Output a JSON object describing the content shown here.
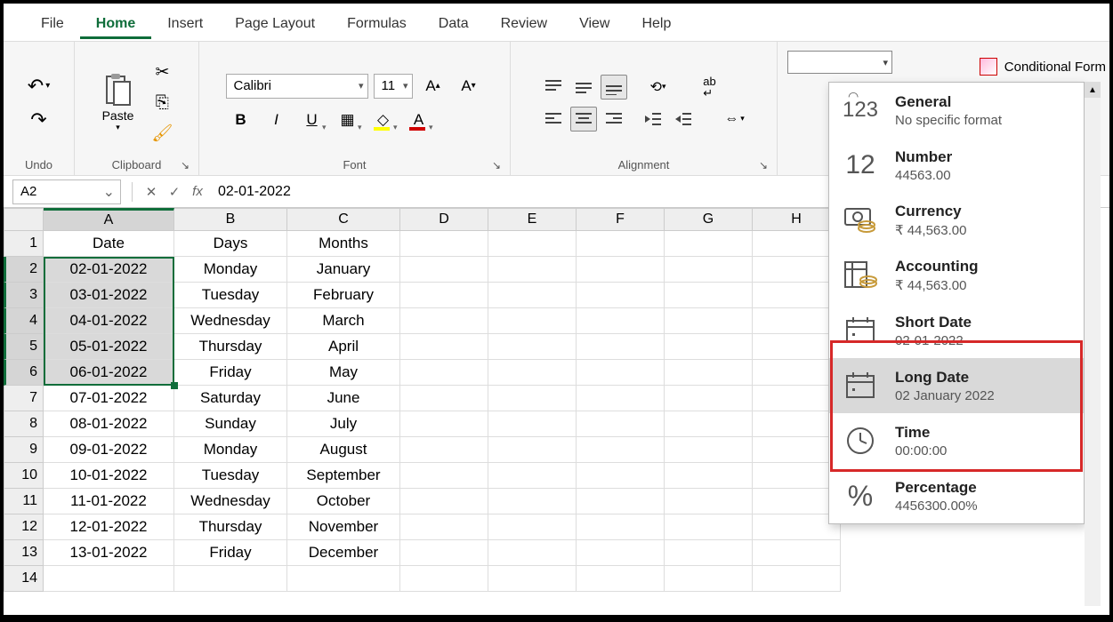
{
  "menu": {
    "file": "File",
    "home": "Home",
    "insert": "Insert",
    "pagelayout": "Page Layout",
    "formulas": "Formulas",
    "data": "Data",
    "review": "Review",
    "view": "View",
    "help": "Help"
  },
  "ribbon": {
    "undo_label": "Undo",
    "clipboard_label": "Clipboard",
    "paste": "Paste",
    "font_label": "Font",
    "font_name": "Calibri",
    "font_size": "11",
    "alignment_label": "Alignment",
    "number_combo": "",
    "cond_format": "Conditional Form"
  },
  "formula_bar": {
    "namebox": "A2",
    "fx": "fx",
    "value": "02-01-2022"
  },
  "grid": {
    "col_labels": [
      "A",
      "B",
      "C",
      "D",
      "E",
      "F",
      "G",
      "H"
    ],
    "headers": {
      "A": "Date",
      "B": "Days",
      "C": "Months"
    },
    "rows": [
      {
        "n": 1,
        "A": "Date",
        "B": "Days",
        "C": "Months"
      },
      {
        "n": 2,
        "A": "02-01-2022",
        "B": "Monday",
        "C": "January"
      },
      {
        "n": 3,
        "A": "03-01-2022",
        "B": "Tuesday",
        "C": "February"
      },
      {
        "n": 4,
        "A": "04-01-2022",
        "B": "Wednesday",
        "C": "March"
      },
      {
        "n": 5,
        "A": "05-01-2022",
        "B": "Thursday",
        "C": "April"
      },
      {
        "n": 6,
        "A": "06-01-2022",
        "B": "Friday",
        "C": "May"
      },
      {
        "n": 7,
        "A": "07-01-2022",
        "B": "Saturday",
        "C": "June"
      },
      {
        "n": 8,
        "A": "08-01-2022",
        "B": "Sunday",
        "C": "July"
      },
      {
        "n": 9,
        "A": "09-01-2022",
        "B": "Monday",
        "C": "August"
      },
      {
        "n": 10,
        "A": "10-01-2022",
        "B": "Tuesday",
        "C": "September"
      },
      {
        "n": 11,
        "A": "11-01-2022",
        "B": "Wednesday",
        "C": "October"
      },
      {
        "n": 12,
        "A": "12-01-2022",
        "B": "Thursday",
        "C": "November"
      },
      {
        "n": 13,
        "A": "13-01-2022",
        "B": "Friday",
        "C": "December"
      },
      {
        "n": 14,
        "A": "",
        "B": "",
        "C": ""
      }
    ],
    "selected_rows": [
      2,
      3,
      4,
      5,
      6
    ],
    "selected_col": "A"
  },
  "format_dropdown": {
    "items": [
      {
        "icon": "123",
        "title": "General",
        "sub": "No specific format"
      },
      {
        "icon": "12",
        "title": "Number",
        "sub": "44563.00"
      },
      {
        "icon": "cur",
        "title": "Currency",
        "sub": "₹ 44,563.00"
      },
      {
        "icon": "acc",
        "title": "Accounting",
        "sub": "₹ 44,563.00"
      },
      {
        "icon": "cal",
        "title": "Short Date",
        "sub": "02-01-2022"
      },
      {
        "icon": "cal",
        "title": "Long Date",
        "sub": "02 January 2022"
      },
      {
        "icon": "clk",
        "title": "Time",
        "sub": "00:00:00"
      },
      {
        "icon": "pct",
        "title": "Percentage",
        "sub": "4456300.00%"
      }
    ],
    "highlighted_index": 5
  }
}
